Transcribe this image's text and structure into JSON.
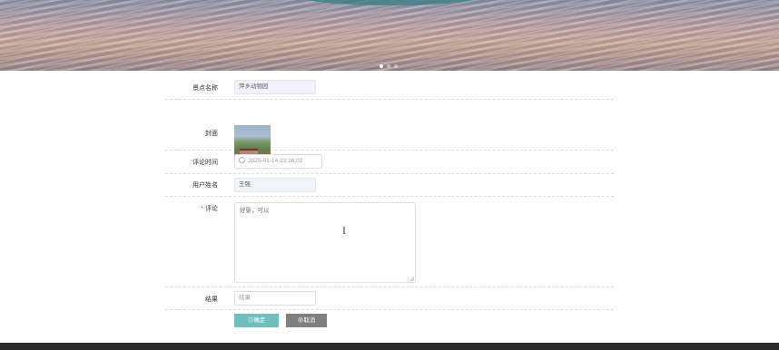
{
  "banner": {
    "slides": 3,
    "active_slide": 1
  },
  "form": {
    "spot_name": {
      "label": "景点名称",
      "value": "萍乡动物园"
    },
    "cover": {
      "label": "封面"
    },
    "comment_time": {
      "label": "评论时间",
      "value": "2025-01-14 23:16:02"
    },
    "user_name": {
      "label": "用户姓名",
      "value": "王强"
    },
    "comment": {
      "required_mark": "*",
      "label": "评论",
      "value": "好耍，可以"
    },
    "result": {
      "label": "结果",
      "placeholder": "结果"
    }
  },
  "actions": {
    "confirm": "⊙确定",
    "cancel": "⊗取消"
  },
  "colors": {
    "confirm_button": "#6fbfbf",
    "cancel_button": "#7f7f7f",
    "footer": "#2b2b2b"
  }
}
